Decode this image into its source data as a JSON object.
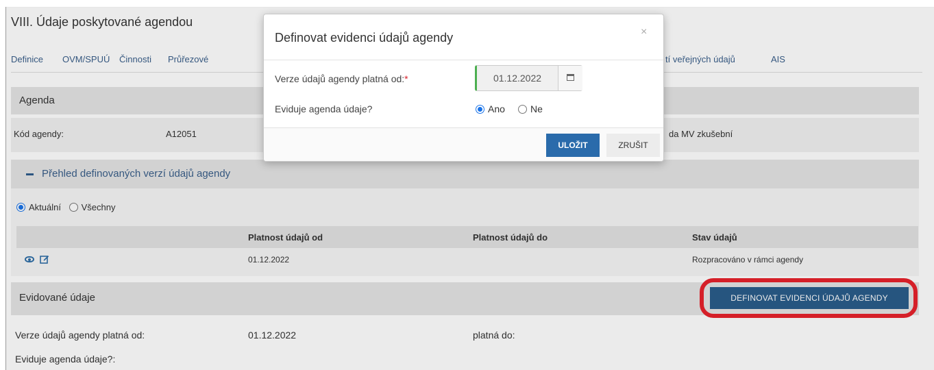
{
  "page": {
    "title": "VIII. Údaje poskytované agendou"
  },
  "nav": {
    "items": [
      "Definice",
      "OVM/SPUÚ",
      "Činnosti",
      "Průřezové",
      "tí veřejných údajů",
      "AIS"
    ]
  },
  "agenda_panel": {
    "heading": "Agenda",
    "code_label": "Kód agendy:",
    "code_value": "A12051",
    "name_fragment": "da MV zkušební"
  },
  "versions_panel": {
    "heading": "Přehled definovaných verzí údajů agendy",
    "filter": {
      "options": [
        "Aktuální",
        "Všechny"
      ],
      "selected": "Aktuální"
    },
    "columns": [
      "",
      "Platnost údajů od",
      "Platnost údajů do",
      "Stav údajů"
    ],
    "rows": [
      {
        "actions": [
          "eye-icon",
          "edit-icon"
        ],
        "valid_from": "01.12.2022",
        "valid_to": "",
        "status": "Rozpracováno v rámci agendy"
      }
    ]
  },
  "evidence_panel": {
    "heading": "Evidované údaje",
    "define_button": "DEFINOVAT EVIDENCI ÚDAJŮ AGENDY",
    "version_label": "Verze údajů agendy platná od:",
    "version_value": "01.12.2022",
    "valid_to_label": "platná do:",
    "evidence_label": "Eviduje agenda údaje?:"
  },
  "modal": {
    "title": "Definovat evidenci údajů agendy",
    "close": "×",
    "date_label": "Verze údajů agendy platná od:",
    "required_mark": "*",
    "date_value": "01.12.2022",
    "evidence_question": "Eviduje agenda údaje?",
    "options": [
      "Ano",
      "Ne"
    ],
    "selected": "Ano",
    "save": "ULOŽIT",
    "cancel": "ZRUŠIT"
  },
  "colors": {
    "accent": "#2a5d8a",
    "highlight_ring": "#e8222c",
    "required": "#d9232d",
    "date_valid_border": "#4caf50"
  }
}
